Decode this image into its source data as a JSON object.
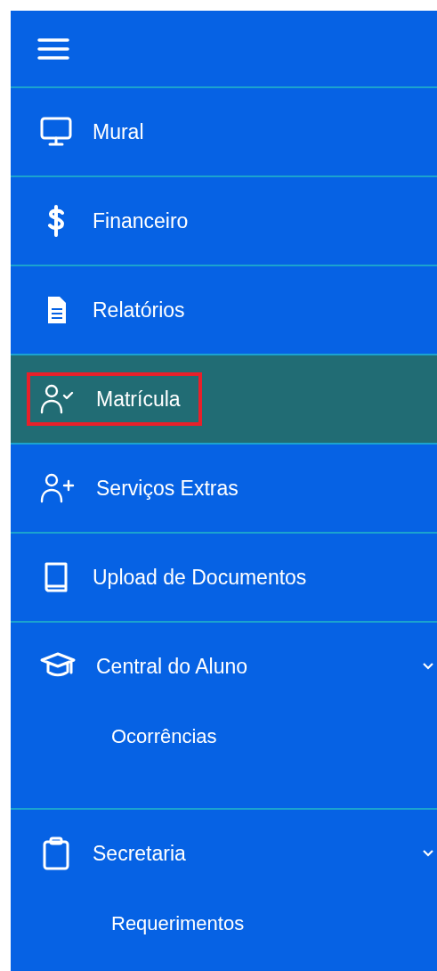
{
  "menu": [
    {
      "kind": "monitor",
      "label": "Mural",
      "selected": false
    },
    {
      "kind": "dollar",
      "label": "Financeiro",
      "selected": false
    },
    {
      "kind": "document",
      "label": "Relatórios",
      "selected": false
    },
    {
      "kind": "user-check",
      "label": "Matrícula",
      "selected": true,
      "highlighted": true
    },
    {
      "kind": "user-plus",
      "label": "Serviços Extras",
      "selected": false
    },
    {
      "kind": "book",
      "label": "Upload de Documentos",
      "selected": false
    },
    {
      "kind": "graduation",
      "label": "Central do Aluno",
      "selected": false,
      "expanded": true,
      "children": [
        {
          "label": "Ocorrências"
        }
      ]
    },
    {
      "kind": "clipboard",
      "label": "Secretaria",
      "selected": false,
      "expanded": true,
      "children": [
        {
          "label": "Requerimentos"
        }
      ]
    }
  ]
}
